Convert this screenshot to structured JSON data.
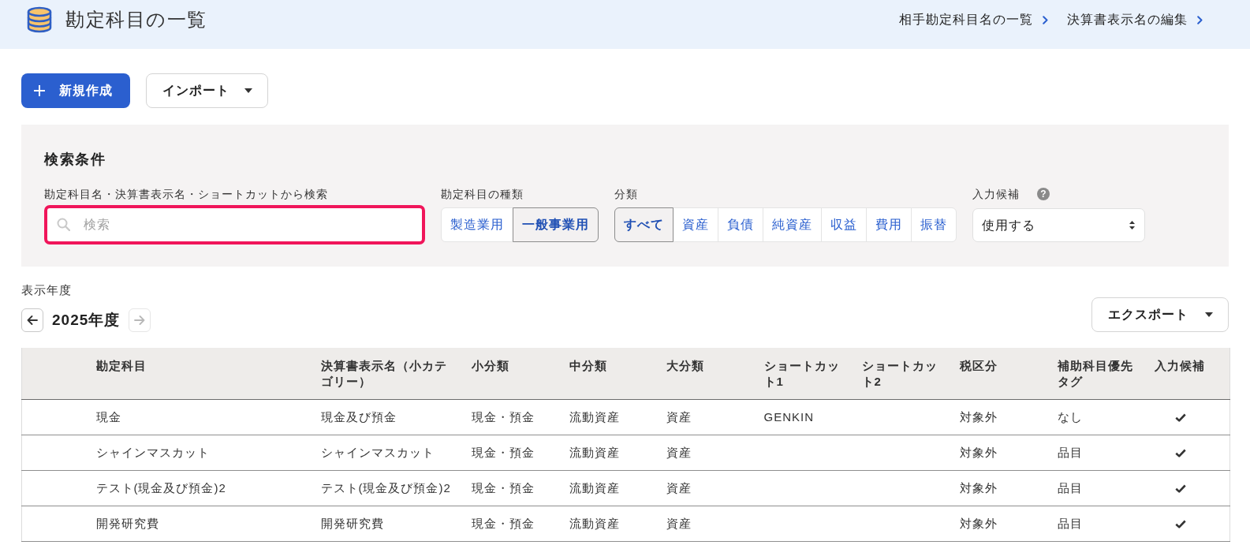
{
  "header": {
    "title": "勘定科目の一覧",
    "links": [
      {
        "label": "相手勘定科目名の一覧"
      },
      {
        "label": "決算書表示名の編集"
      }
    ]
  },
  "actions": {
    "new_button": "新規作成",
    "import_button": "インポート"
  },
  "search_panel": {
    "title": "検索条件",
    "search": {
      "label": "勘定科目名・決算書表示名・ショートカットから検索",
      "placeholder": "検索",
      "focused": true
    },
    "account_type": {
      "label": "勘定科目の種類",
      "options": [
        {
          "label": "製造業用",
          "selected": false
        },
        {
          "label": "一般事業用",
          "selected": true
        }
      ]
    },
    "category": {
      "label": "分類",
      "options": [
        {
          "label": "すべて",
          "selected": true
        },
        {
          "label": "資産",
          "selected": false
        },
        {
          "label": "負債",
          "selected": false
        },
        {
          "label": "純資産",
          "selected": false
        },
        {
          "label": "収益",
          "selected": false
        },
        {
          "label": "費用",
          "selected": false
        },
        {
          "label": "振替",
          "selected": false
        }
      ]
    },
    "input_candidate": {
      "label": "入力候補",
      "help": "?",
      "value": "使用する"
    }
  },
  "fiscal_year": {
    "label": "表示年度",
    "value": "2025年度",
    "prev": {
      "disabled": false
    },
    "next": {
      "disabled": true
    }
  },
  "export_button": "エクスポート",
  "table": {
    "columns": [
      "勘定科目",
      "決算書表示名（小カテゴリー）",
      "小分類",
      "中分類",
      "大分類",
      "ショートカット1",
      "ショートカット2",
      "税区分",
      "補助科目優先タグ",
      "入力候補"
    ],
    "rows": [
      {
        "account": "現金",
        "statement_name": "現金及び預金",
        "sub_category": "現金・預金",
        "mid_category": "流動資産",
        "major_category": "資産",
        "shortcut_1": "GENKIN",
        "tax_category": "対象外",
        "priority_tag": "なし",
        "input_candidate": true
      },
      {
        "account": "シャインマスカット",
        "statement_name": "シャインマスカット",
        "sub_category": "現金・預金",
        "mid_category": "流動資産",
        "major_category": "資産",
        "tax_category": "対象外",
        "priority_tag": "品目",
        "input_candidate": true
      },
      {
        "account": "テスト(現金及び預金)2",
        "statement_name": "テスト(現金及び預金)2",
        "sub_category": "現金・預金",
        "mid_category": "流動資産",
        "major_category": "資産",
        "tax_category": "対象外",
        "priority_tag": "品目",
        "input_candidate": true
      },
      {
        "account": "開発研究費",
        "statement_name": "開発研究費",
        "sub_category": "現金・預金",
        "mid_category": "流動資産",
        "major_category": "資産",
        "tax_category": "対象外",
        "priority_tag": "品目",
        "input_candidate": true
      }
    ]
  }
}
